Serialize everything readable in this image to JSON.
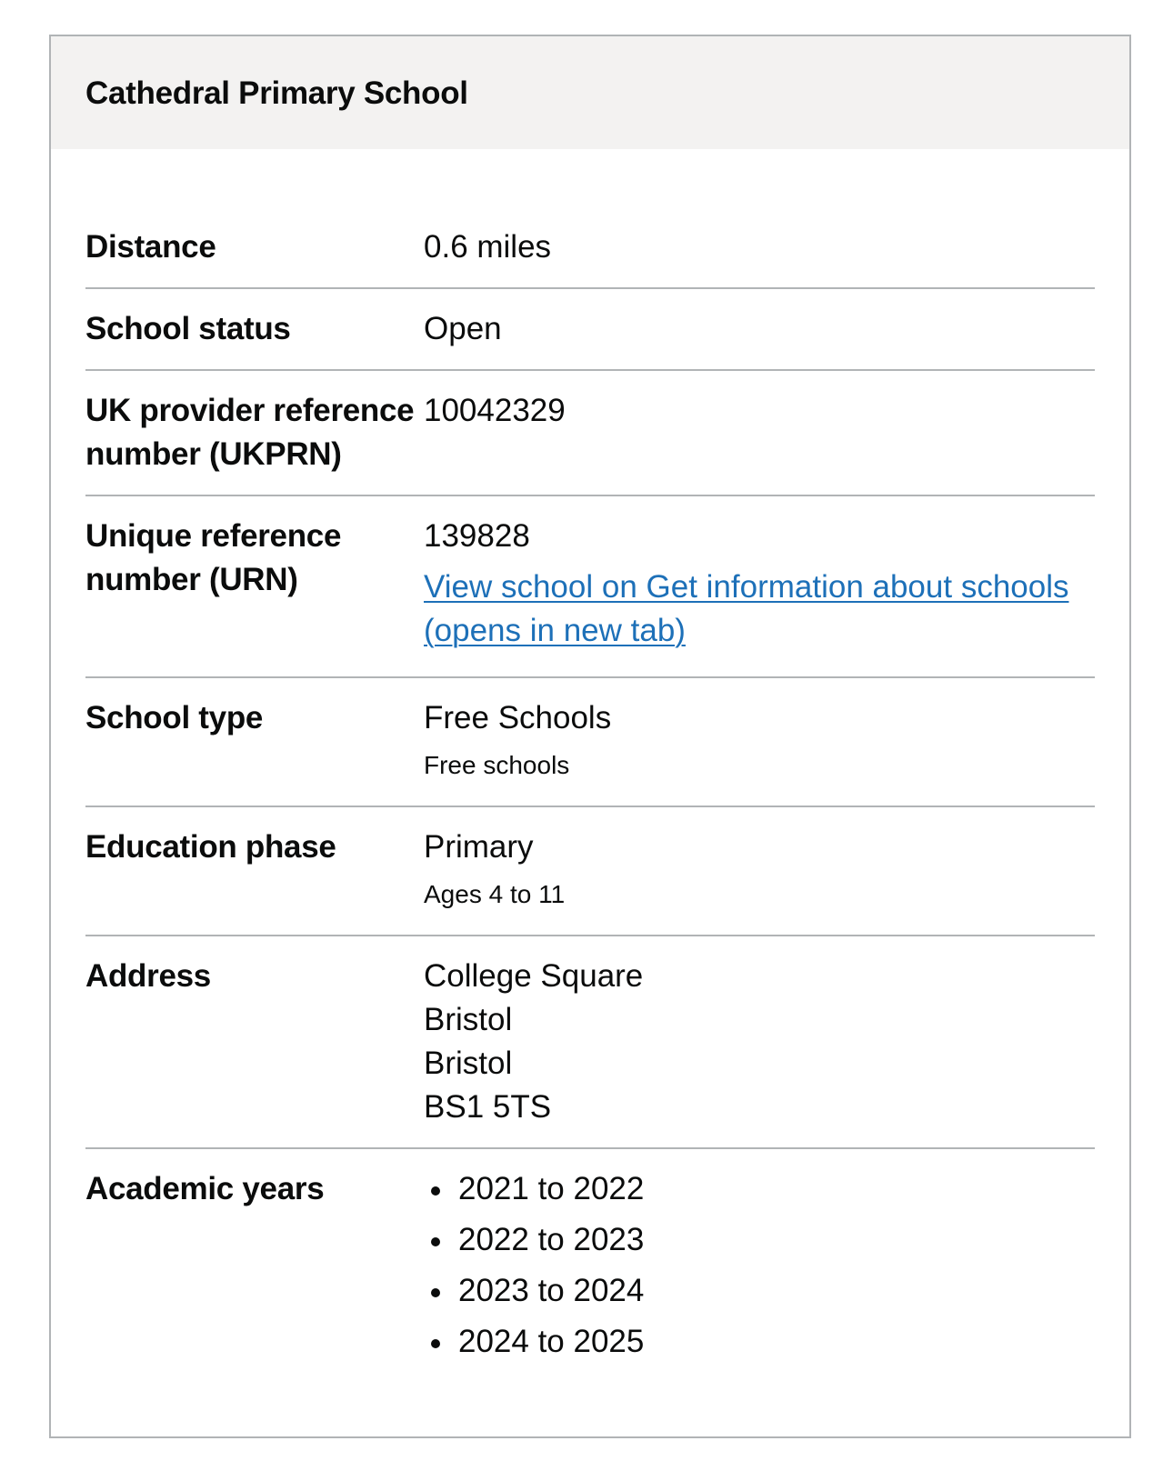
{
  "card": {
    "title": "Cathedral Primary School"
  },
  "rows": {
    "distance": {
      "key": "Distance",
      "value": "0.6 miles"
    },
    "status": {
      "key": "School status",
      "value": "Open"
    },
    "ukprn": {
      "key": "UK provider reference number (UKPRN)",
      "value": "10042329"
    },
    "urn": {
      "key": "Unique reference number (URN)",
      "value": "139828",
      "link": "View school on Get information about schools (opens in new tab)"
    },
    "type": {
      "key": "School type",
      "value": "Free Schools",
      "hint": "Free schools"
    },
    "phase": {
      "key": "Education phase",
      "value": "Primary",
      "hint": "Ages 4 to 11"
    },
    "address": {
      "key": "Address",
      "lines": [
        "College Square",
        "Bristol",
        "Bristol",
        "BS1 5TS"
      ]
    },
    "years": {
      "key": "Academic years",
      "items": [
        "2021 to 2022",
        "2022 to 2023",
        "2023 to 2024",
        "2024 to 2025"
      ]
    }
  },
  "colors": {
    "link": "#1d70b8",
    "header_bg": "#f3f2f1",
    "border": "#b1b4b6",
    "text": "#0b0c0c"
  }
}
